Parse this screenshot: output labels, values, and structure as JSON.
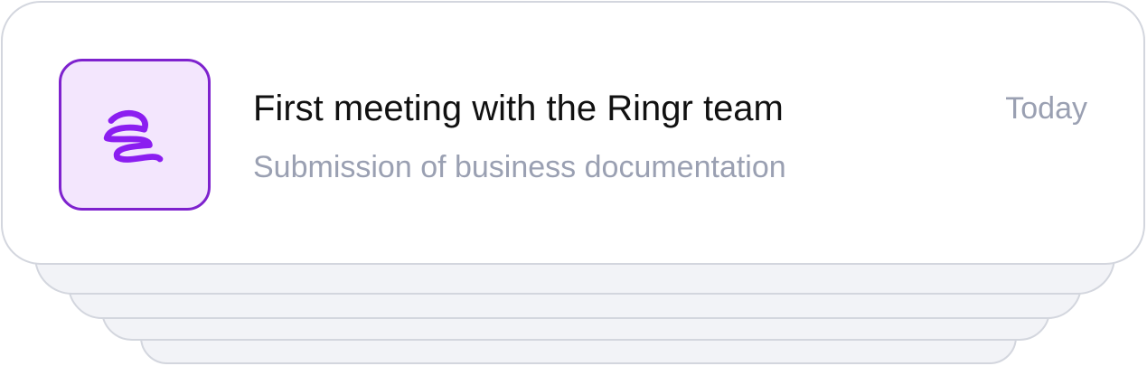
{
  "notification": {
    "title": "First meeting with the Ringr team",
    "subtitle": "Submission of business documentation",
    "time": "Today",
    "icon": "ringr-spiral-icon",
    "accent_color": "#8b1ef0",
    "icon_bg_color": "#f3e6fd"
  }
}
